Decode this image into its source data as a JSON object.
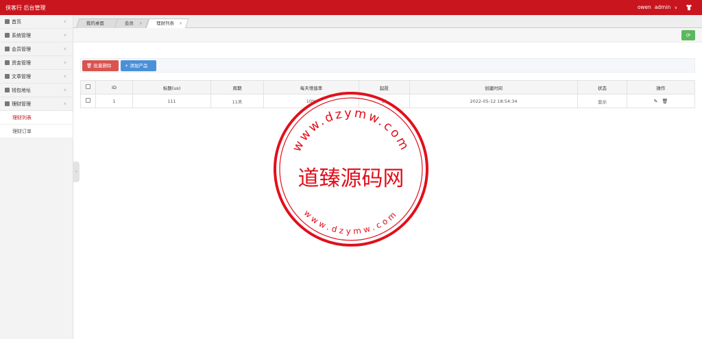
{
  "header": {
    "title": "侠客行 后台管理",
    "username": "owen",
    "role_menu": "admin",
    "caret": "∨"
  },
  "sidebar": {
    "items": [
      {
        "label": "首页"
      },
      {
        "label": "系统管理"
      },
      {
        "label": "会员管理"
      },
      {
        "label": "资金管理"
      },
      {
        "label": "文章管理"
      },
      {
        "label": "钱包地址"
      },
      {
        "label": "理财管理"
      }
    ],
    "sub_items": [
      {
        "label": "理财列表",
        "active": true
      },
      {
        "label": "理财订单",
        "active": false
      }
    ],
    "collapse_glyph": "‹"
  },
  "tabs": [
    {
      "label": "我的桌面",
      "closable": false
    },
    {
      "label": "会员",
      "closable": true
    },
    {
      "label": "理财列表",
      "closable": true,
      "active": true
    }
  ],
  "toolbar": {
    "batch_delete_label": "批量删除",
    "add_product_label": "添加产品",
    "refresh_glyph": "⟳"
  },
  "table": {
    "headers": [
      "ID",
      "标题(us)",
      "周期",
      "每天增值率",
      "起投",
      "创建时间",
      "状态",
      "操作"
    ],
    "rows": [
      {
        "id": "1",
        "title": "111",
        "period": "11天",
        "daily_rate": "10%",
        "min_invest": "11",
        "created": "2022-05-12 18:54:34",
        "status": "显示"
      }
    ]
  },
  "watermark": {
    "center_text": "道臻源码网",
    "top_arc": "www.dzymw.com",
    "bottom_arc": "www.dzymw.com",
    "color": "#e0101c"
  },
  "colors": {
    "brand_red": "#c9151e",
    "success": "#5cb85c",
    "danger": "#d9534f",
    "primary": "#4a90d9"
  }
}
